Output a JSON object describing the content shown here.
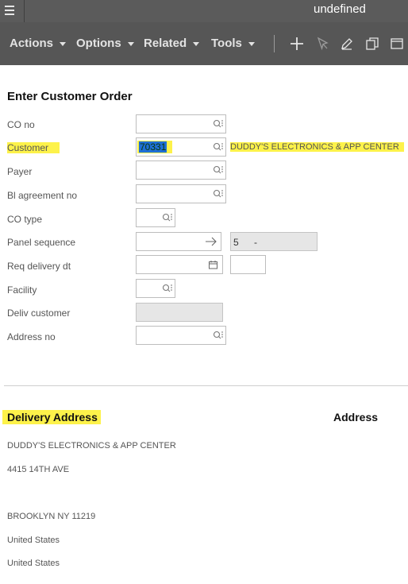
{
  "app": {
    "title": "undefined"
  },
  "toolbar": {
    "actions_label": "Actions",
    "options_label": "Options",
    "related_label": "Related",
    "tools_label": "Tools",
    "icons": [
      "add-icon",
      "select-cursor-icon",
      "edit-pencil-icon",
      "copy-icon",
      "window-icon"
    ]
  },
  "form": {
    "heading": "Enter Customer Order",
    "co_no": {
      "label": "CO no",
      "value": ""
    },
    "customer": {
      "label": "Customer",
      "value": "70331",
      "name": "DUDDY'S ELECTRONICS & APP CENTER"
    },
    "payer": {
      "label": "Payer",
      "value": ""
    },
    "bl_agreement": {
      "label": "Bl agreement no",
      "value": ""
    },
    "co_type": {
      "label": "CO type",
      "value": ""
    },
    "panel_sequence": {
      "label": "Panel sequence",
      "value": "",
      "display": "5",
      "display_suffix": "-"
    },
    "req_delivery": {
      "label": "Req delivery dt",
      "value": ""
    },
    "facility": {
      "label": "Facility",
      "value": ""
    },
    "deliv_customer": {
      "label": "Deliv customer",
      "value": ""
    },
    "address_no": {
      "label": "Address no",
      "value": ""
    }
  },
  "delivery": {
    "heading": "Delivery Address",
    "right_heading": "Address",
    "lines": [
      "DUDDY'S ELECTRONICS & APP CENTER",
      "4415 14TH AVE",
      "BROOKLYN NY 11219",
      "United States",
      "United States"
    ]
  },
  "colors": {
    "topbar": "#5b5b5b",
    "toolbar": "#565656",
    "highlight": "#fdf24a",
    "selection": "#1f6fd6"
  }
}
